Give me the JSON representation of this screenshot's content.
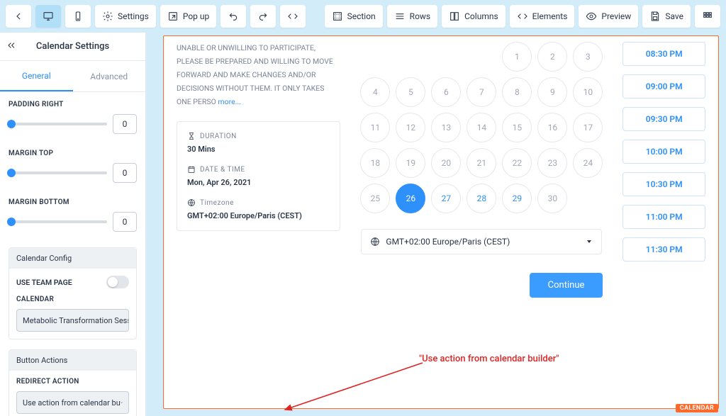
{
  "topbar": {
    "settings": "Settings",
    "popup": "Pop up",
    "section": "Section",
    "rows": "Rows",
    "columns": "Columns",
    "elements": "Elements",
    "preview": "Preview",
    "save": "Save"
  },
  "sidebar": {
    "title": "Calendar Settings",
    "tabs": {
      "general": "General",
      "advanced": "Advanced"
    },
    "sliders": {
      "padding_right": {
        "label": "PADDING RIGHT",
        "value": "0"
      },
      "margin_top": {
        "label": "MARGIN TOP",
        "value": "0"
      },
      "margin_bottom": {
        "label": "MARGIN BOTTOM",
        "value": "0"
      }
    },
    "config": {
      "header": "Calendar Config",
      "use_team": "USE TEAM PAGE",
      "calendar_label": "CALENDAR",
      "calendar_value": "Metabolic Transformation Sess"
    },
    "actions": {
      "header": "Button Actions",
      "redirect_label": "REDIRECT ACTION",
      "redirect_value": "Use action from calendar bu"
    }
  },
  "widget": {
    "disclaimer": "UNABLE OR UNWILLING TO PARTICIPATE, PLEASE BE PREPARED AND WILLING TO MOVE FORWARD AND MAKE CHANGES AND/OR DECISIONS WITHOUT THEM. IT ONLY TAKES ONE PERSO ",
    "more": "more...",
    "duration": {
      "label": "DURATION",
      "value": "30 Mins"
    },
    "datetime": {
      "label": "DATE & TIME",
      "value": "Mon, Apr 26, 2021"
    },
    "timezone": {
      "label": "Timezone",
      "value": "GMT+02:00 Europe/Paris (CEST)"
    },
    "tz_selector_value": "GMT+02:00 Europe/Paris (CEST)",
    "continue": "Continue",
    "tag": "CALENDAR",
    "days_row1": [
      "1",
      "2",
      "3"
    ],
    "days": [
      "4",
      "5",
      "6",
      "7",
      "8",
      "9",
      "10",
      "11",
      "12",
      "13",
      "14",
      "15",
      "16",
      "17",
      "18",
      "19",
      "20",
      "21",
      "22",
      "23",
      "24",
      "25",
      "26",
      "27",
      "28",
      "29",
      "30"
    ],
    "available": [
      "26",
      "27",
      "28",
      "29"
    ],
    "selected": "26",
    "timeslots": [
      "08:30 PM",
      "09:00 PM",
      "09:30 PM",
      "10:00 PM",
      "10:30 PM",
      "11:00 PM",
      "11:30 PM"
    ]
  },
  "annotation": {
    "text": "\"Use action from calendar builder\""
  }
}
